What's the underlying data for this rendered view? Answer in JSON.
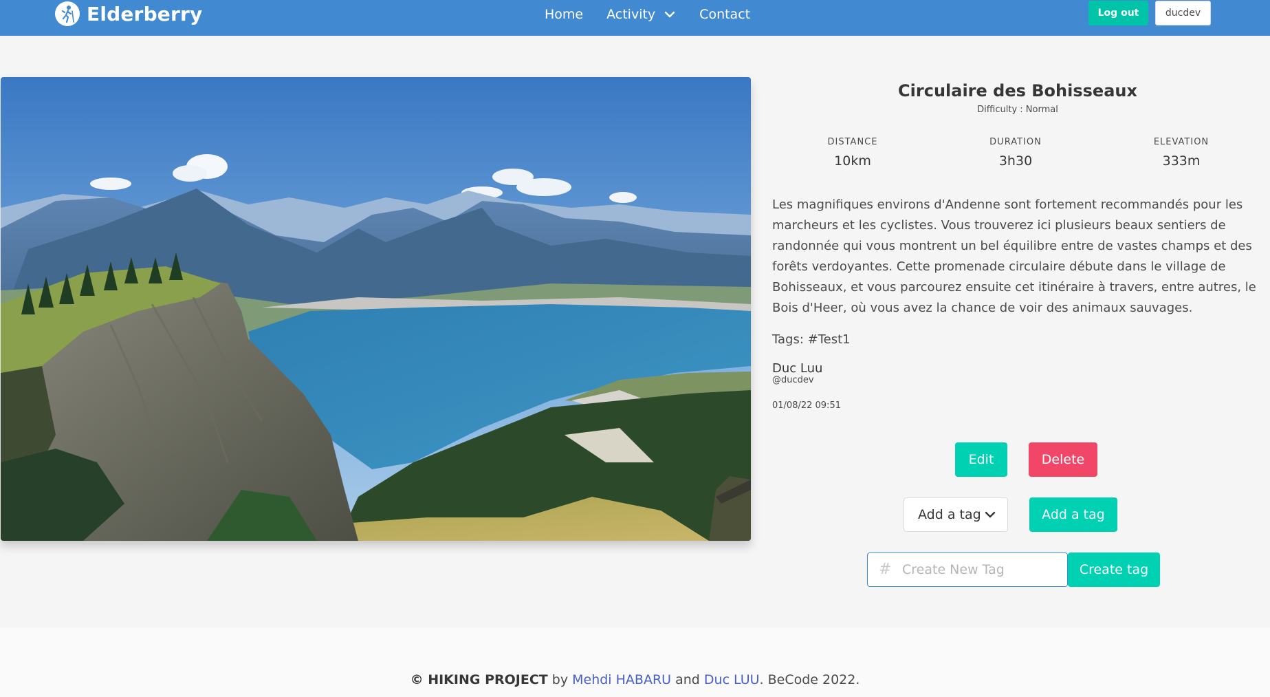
{
  "brand": {
    "name": "Elderberry",
    "logo_icon": "hiker-icon"
  },
  "nav": {
    "home": "Home",
    "activity": "Activity",
    "contact": "Contact",
    "logout": "Log out",
    "username": "ducdev"
  },
  "hike": {
    "title": "Circulaire des Bohisseaux",
    "difficulty": "Difficulty : Normal",
    "stats": [
      {
        "label": "DISTANCE",
        "value": "10km"
      },
      {
        "label": "DURATION",
        "value": "3h30"
      },
      {
        "label": "ELEVATION",
        "value": "333m"
      }
    ],
    "description": "Les magnifiques environs d'Andenne sont fortement recommandés pour les marcheurs et les cyclistes. Vous trouverez ici plusieurs beaux sentiers de randonnée qui vous montrent un bel équilibre entre de vastes champs et des forêts verdoyantes. Cette promenade circulaire débute dans le village de Bohisseaux, et vous parcourez ensuite cet itinéraire à travers, entre autres, le Bois d'Heer, où vous avez la chance de voir des animaux sauvages.",
    "tags": "Tags: #Test1",
    "author_name": "Duc Luu",
    "author_handle": "@ducdev",
    "date": "01/08/22 09:51"
  },
  "actions": {
    "edit": "Edit",
    "delete": "Delete",
    "select_tag": "Add a tag",
    "add_tag": "Add a tag",
    "new_tag_placeholder": "Create New Tag",
    "create_tag": "Create tag"
  },
  "footer": {
    "copyright": "© HIKING PROJECT",
    "by": " by ",
    "author1": "Mehdi HABARU",
    "and": " and ",
    "author2": "Duc LUU",
    "suffix": ". BeCode 2022."
  },
  "colors": {
    "navbar": "#418ad2",
    "primary": "#00d1b2",
    "danger": "#f14668",
    "link": "#485fc7"
  }
}
